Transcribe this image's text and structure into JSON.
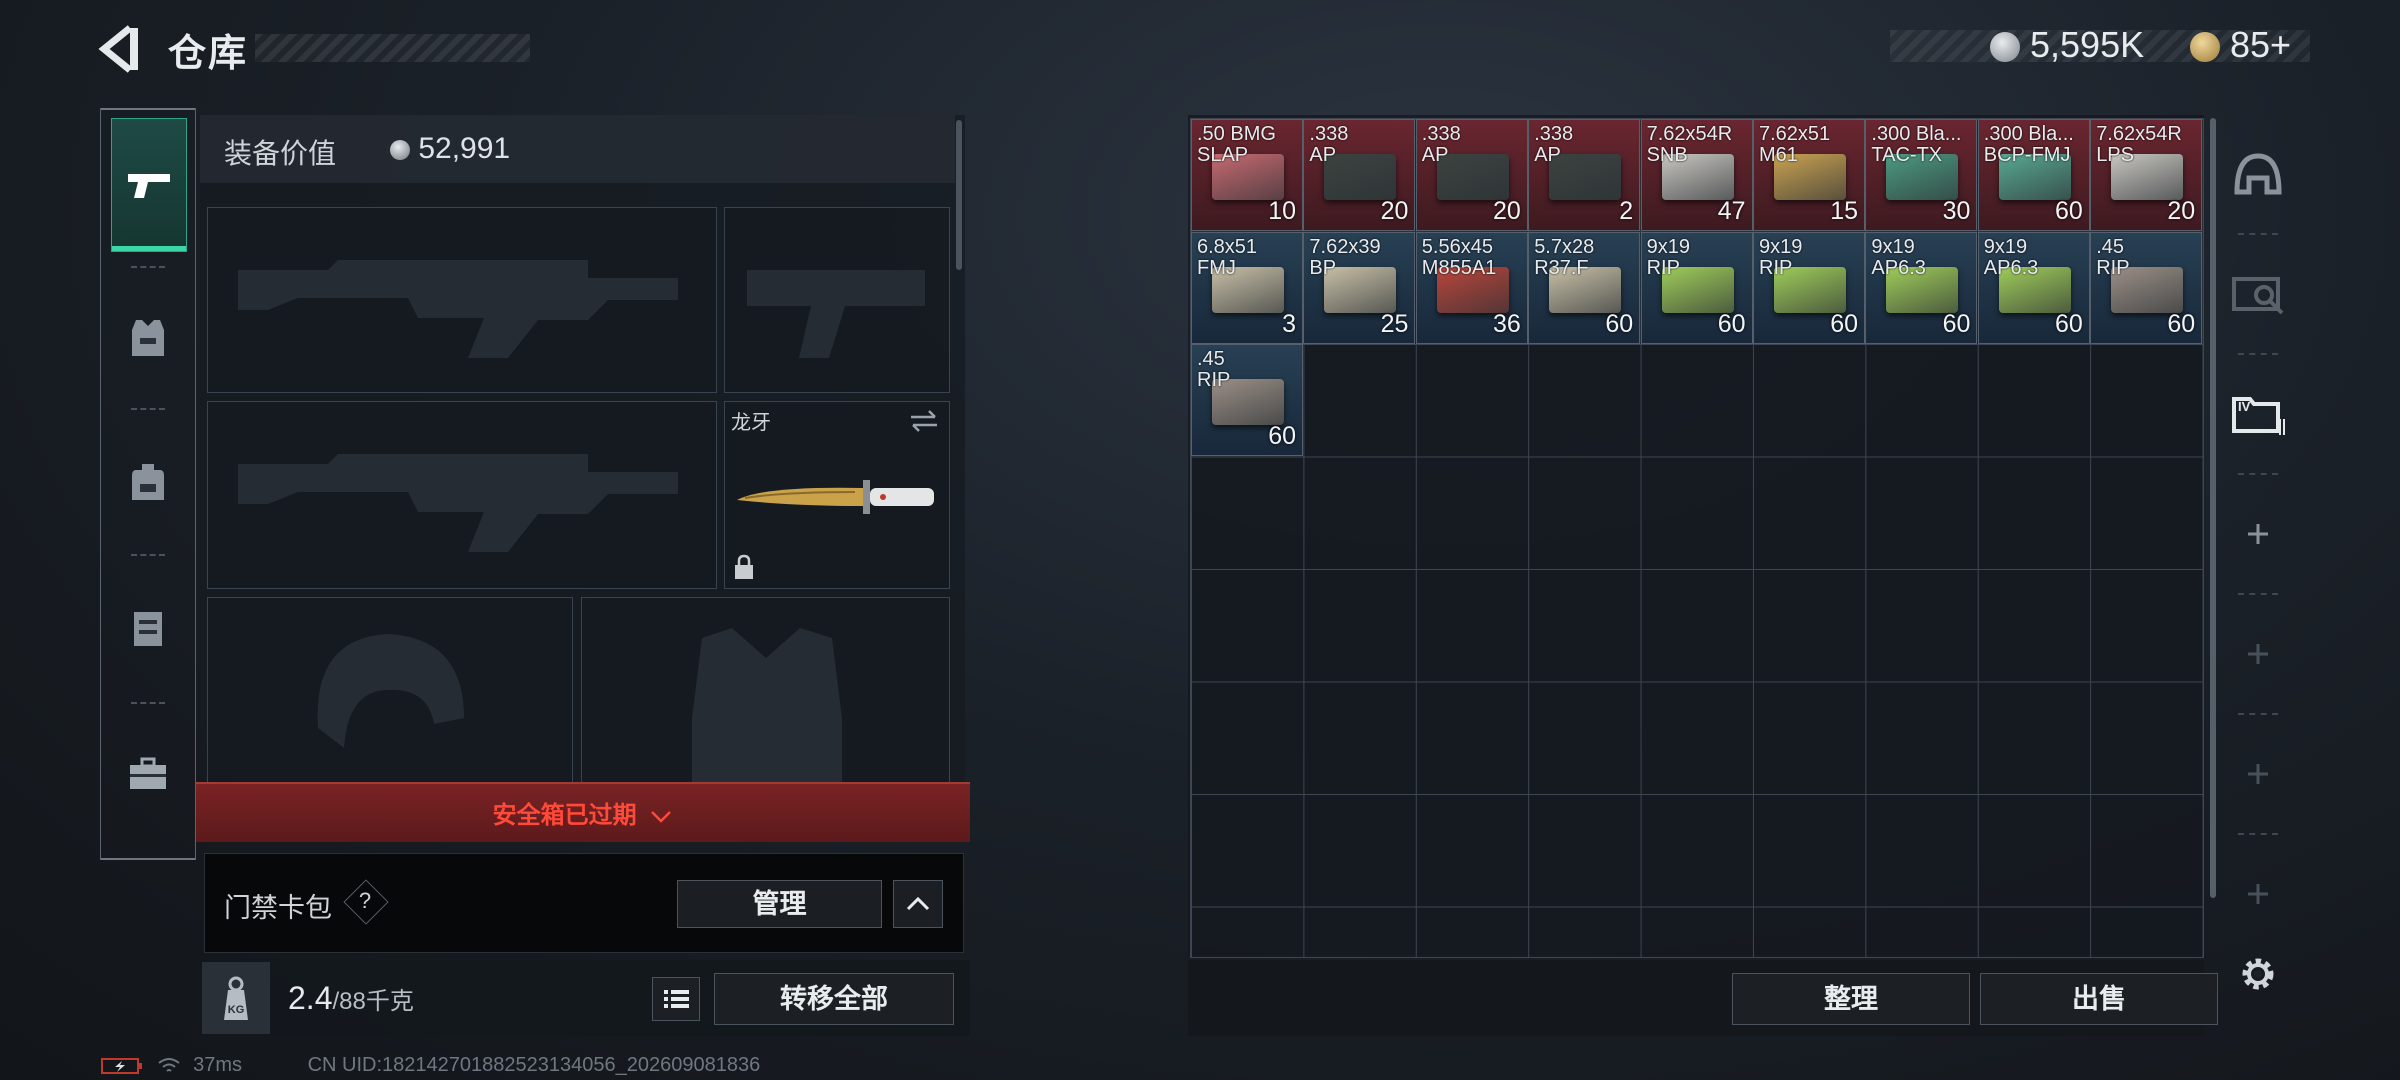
{
  "header": {
    "title": "仓库"
  },
  "currency": [
    {
      "icon": "silver-coin-icon",
      "value": "5,595K"
    },
    {
      "icon": "gold-coin-icon",
      "value": "85+"
    }
  ],
  "equipment": {
    "value_label": "装备价值",
    "value": "52,991",
    "melee": {
      "name": "龙牙"
    }
  },
  "safe_box": {
    "text": "安全箱已过期"
  },
  "card_pack": {
    "label": "门禁卡包",
    "help": "?",
    "manage": "管理"
  },
  "bottom": {
    "weight_icon": "KG",
    "weight_current": "2.4",
    "weight_max": "/88千克",
    "transfer_all": "转移全部",
    "sort": "整理",
    "sell": "出售"
  },
  "status": {
    "ping": "37ms",
    "uid": "CN UID:182142701882523134056_202609081836"
  },
  "ammo": [
    {
      "caliber": ".50 BMG",
      "type": "SLAP",
      "qty": "10",
      "rarity": "red",
      "box": "#c66a70"
    },
    {
      "caliber": ".338",
      "type": "AP",
      "qty": "20",
      "rarity": "red",
      "box": "#3b4340"
    },
    {
      "caliber": ".338",
      "type": "AP",
      "qty": "20",
      "rarity": "red",
      "box": "#3b4340"
    },
    {
      "caliber": ".338",
      "type": "AP",
      "qty": "2",
      "rarity": "red",
      "box": "#3b4340"
    },
    {
      "caliber": "7.62x54R",
      "type": "SNB",
      "qty": "47",
      "rarity": "red",
      "box": "#c8c6c0"
    },
    {
      "caliber": "7.62x51",
      "type": "M61",
      "qty": "15",
      "rarity": "red",
      "box": "#c9a252"
    },
    {
      "caliber": ".300 Bla...",
      "type": "TAC-TX",
      "qty": "30",
      "rarity": "red",
      "box": "#4c9a80"
    },
    {
      "caliber": ".300 Bla...",
      "type": "BCP-FMJ",
      "qty": "60",
      "rarity": "red",
      "box": "#58a891"
    },
    {
      "caliber": "7.62x54R",
      "type": "LPS",
      "qty": "20",
      "rarity": "red",
      "box": "#c8c6c0"
    },
    {
      "caliber": "6.8x51",
      "type": "FMJ",
      "qty": "3",
      "rarity": "blue",
      "box": "#c7bfa6"
    },
    {
      "caliber": "7.62x39",
      "type": "BP",
      "qty": "25",
      "rarity": "blue",
      "box": "#c7bfa6"
    },
    {
      "caliber": "5.56x45",
      "type": "M855A1",
      "qty": "36",
      "rarity": "blue",
      "box": "#b8463c"
    },
    {
      "caliber": "5.7x28",
      "type": "R37.F",
      "qty": "60",
      "rarity": "blue",
      "box": "#c7bfa6"
    },
    {
      "caliber": "9x19",
      "type": "RIP",
      "qty": "60",
      "rarity": "blue",
      "box": "#9fcc5a"
    },
    {
      "caliber": "9x19",
      "type": "RIP",
      "qty": "60",
      "rarity": "blue",
      "box": "#9fcc5a"
    },
    {
      "caliber": "9x19",
      "type": "AP6.3",
      "qty": "60",
      "rarity": "blue",
      "box": "#9fcc5a"
    },
    {
      "caliber": "9x19",
      "type": "AP6.3",
      "qty": "60",
      "rarity": "blue",
      "box": "#9fcc5a"
    },
    {
      "caliber": ".45",
      "type": "RIP",
      "qty": "60",
      "rarity": "blue",
      "box": "#9a8f86"
    },
    {
      "caliber": ".45",
      "type": "RIP",
      "qty": "60",
      "rarity": "blue",
      "box": "#9a8f86"
    }
  ],
  "colors": {
    "accent": "#3dd6a8",
    "red_rarity": "#5a2128",
    "blue_rarity": "#1f3242",
    "warning": "#ff4a3a"
  },
  "left_nav": [
    "gun-icon",
    "armor-vest-icon",
    "backpack-icon",
    "chest-rig-icon",
    "briefcase-icon"
  ],
  "right_nav": [
    "helmet-icon",
    "scanner-icon",
    "safe-folder-icon",
    "add-icon",
    "add-icon",
    "add-icon",
    "add-icon",
    "settings-icon"
  ]
}
